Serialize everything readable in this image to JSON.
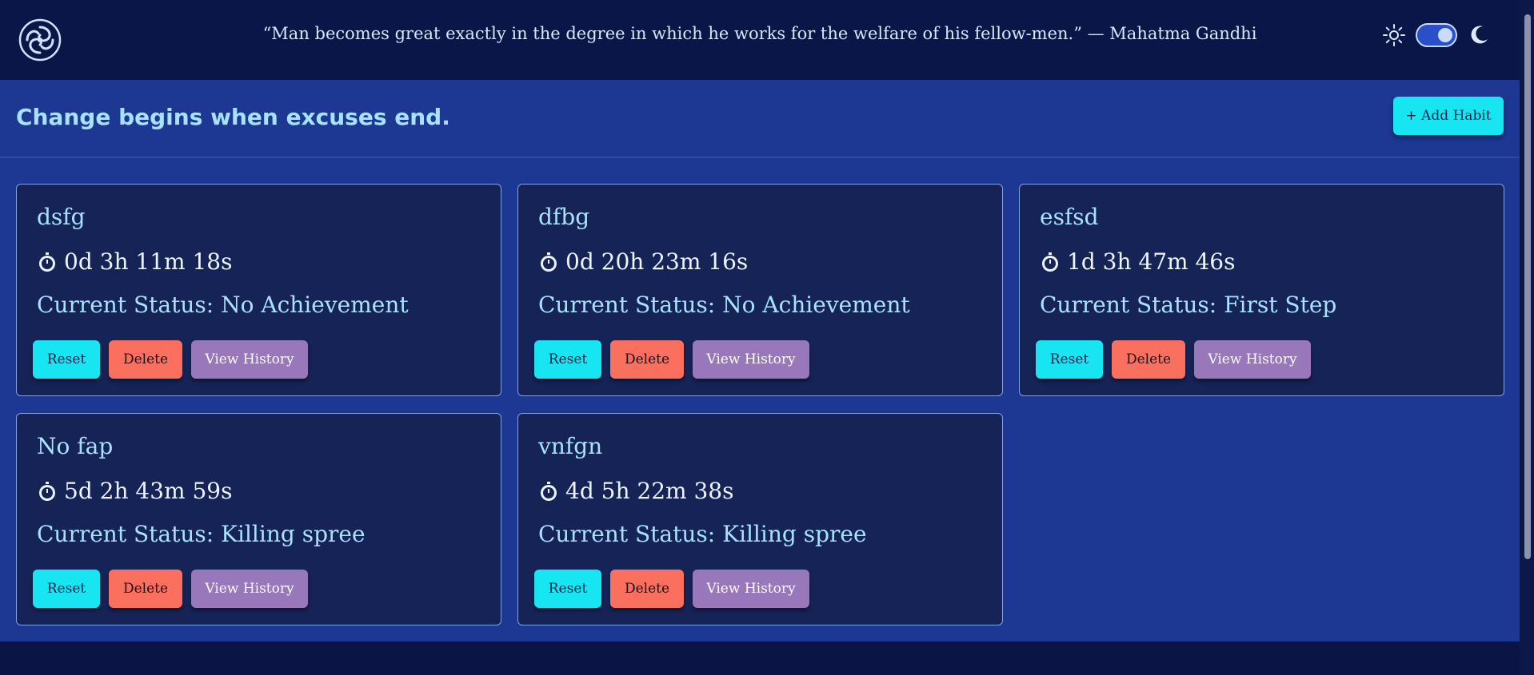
{
  "header": {
    "quote": "“Man becomes great exactly in the degree in which he works for the welfare of his fellow-men.” — Mahatma Gandhi",
    "logo_icon": "spiral-logo-icon",
    "theme": {
      "light_icon": "sun-icon",
      "dark_icon": "moon-icon",
      "mode": "dark"
    }
  },
  "main": {
    "title": "Change begins when excuses end.",
    "add_button_label": "+ Add Habit"
  },
  "habits": [
    {
      "name": "dsfg",
      "timer": "0d 3h 11m 18s",
      "status": "Current Status: No Achievement"
    },
    {
      "name": "dfbg",
      "timer": "0d 20h 23m 16s",
      "status": "Current Status: No Achievement"
    },
    {
      "name": "esfsd",
      "timer": "1d 3h 47m 46s",
      "status": "Current Status: First Step"
    },
    {
      "name": "No fap",
      "timer": "5d 2h 43m 59s",
      "status": "Current Status: Killing spree"
    },
    {
      "name": "vnfgn",
      "timer": "4d 5h 22m 38s",
      "status": "Current Status: Killing spree"
    }
  ],
  "buttons": {
    "reset": "Reset",
    "delete": "Delete",
    "history": "View History"
  },
  "colors": {
    "accent_cyan": "#17e6f2",
    "delete_red": "#fb6f5f",
    "history_purple": "#9977bb",
    "background": "#1c3892",
    "card": "#162356"
  }
}
